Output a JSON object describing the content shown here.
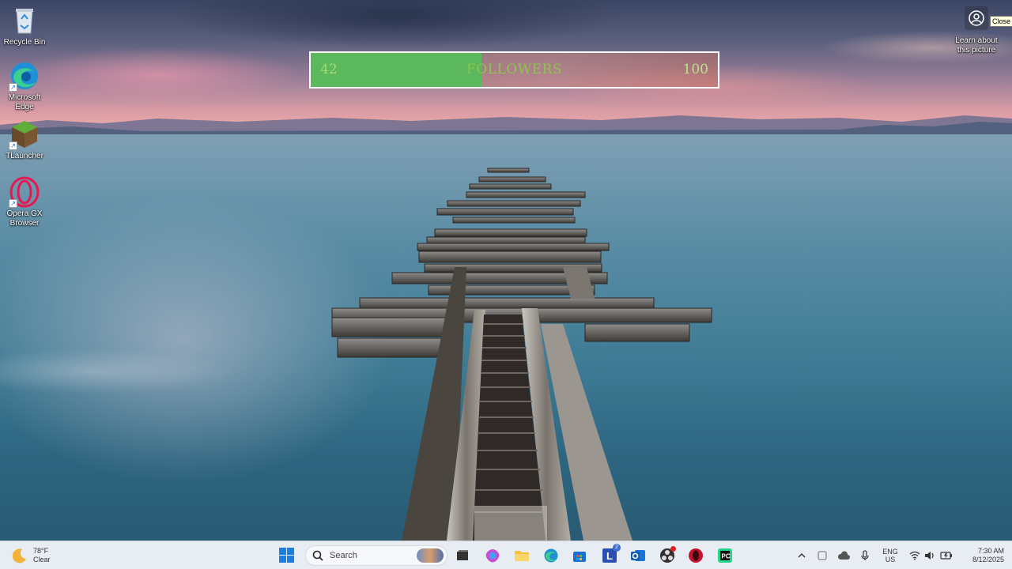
{
  "desktop": {
    "icons": [
      {
        "label": "Recycle Bin",
        "icon": "recycle-bin-icon"
      },
      {
        "label": "Microsoft Edge",
        "icon": "edge-icon"
      },
      {
        "label": "TLauncher",
        "icon": "tlauncher-icon"
      },
      {
        "label": "Opera GX Browser",
        "icon": "opera-gx-icon"
      }
    ],
    "learn_about": {
      "label": "Learn about this picture",
      "tooltip": "Close"
    }
  },
  "followers_widget": {
    "current": "42",
    "label": "FOLLOWERS",
    "goal": "100",
    "progress": 0.42,
    "fill_color": "#5cb85c"
  },
  "taskbar": {
    "weather": {
      "temp": "78°F",
      "condition": "Clear"
    },
    "search_placeholder": "Search",
    "pinned": [
      {
        "name": "start-button",
        "icon": "windows-logo-icon"
      },
      {
        "name": "task-view",
        "icon": "task-view-icon"
      },
      {
        "name": "copilot",
        "icon": "copilot-icon"
      },
      {
        "name": "file-explorer",
        "icon": "folder-icon"
      },
      {
        "name": "edge",
        "icon": "edge-icon"
      },
      {
        "name": "store",
        "icon": "store-icon"
      },
      {
        "name": "lightspeed",
        "icon": "l-app-icon",
        "badge": "2"
      },
      {
        "name": "outlook",
        "icon": "outlook-icon"
      },
      {
        "name": "obs",
        "icon": "obs-icon"
      },
      {
        "name": "opera-gx",
        "icon": "opera-gx-icon"
      },
      {
        "name": "pycharm",
        "icon": "pycharm-icon"
      }
    ],
    "language": {
      "line1": "ENG",
      "line2": "US"
    },
    "clock": {
      "time": "7:30 AM",
      "date": "8/12/2025"
    }
  }
}
